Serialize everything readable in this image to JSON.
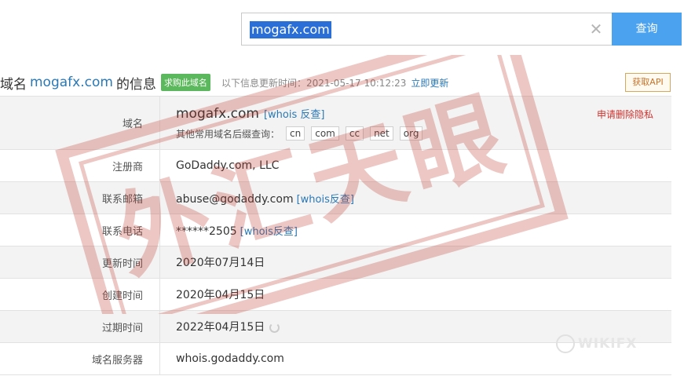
{
  "search": {
    "value": "mogafx.com",
    "clear_icon": "close-icon",
    "button_label": "查询"
  },
  "heading": {
    "prefix": "域名",
    "domain": "mogafx.com",
    "suffix": "的信息",
    "buy_badge": "求购此域名",
    "update_text": "以下信息更新时间：2021-05-17 10:12:23",
    "update_link": "立即更新",
    "api_button": "获取API"
  },
  "table": {
    "domain_row": {
      "label": "域名",
      "domain": "mogafx.com",
      "whois_link": "[whois 反查]",
      "tld_prompt": "其他常用域名后缀查询：",
      "tlds": [
        "cn",
        "com",
        "cc",
        "net",
        "org"
      ],
      "privacy_link": "申请删除隐私"
    },
    "registrar": {
      "label": "注册商",
      "value": "GoDaddy.com, LLC"
    },
    "email": {
      "label": "联系邮箱",
      "value": "abuse@godaddy.com",
      "link": "[whois反查]"
    },
    "phone": {
      "label": "联系电话",
      "value": "******2505",
      "link": "[whois反查]"
    },
    "updated": {
      "label": "更新时间",
      "value": "2020年07月14日"
    },
    "created": {
      "label": "创建时间",
      "value": "2020年04月15日"
    },
    "expires": {
      "label": "过期时间",
      "value": "2022年04月15日"
    },
    "nameserver": {
      "label": "域名服务器",
      "value": "whois.godaddy.com"
    }
  },
  "stamp": {
    "text": "外汇天眼",
    "color": "#c0392b"
  },
  "watermark": {
    "text": "WIKIFX"
  },
  "colors": {
    "accent": "#4ba3ef",
    "link": "#2a78b5",
    "badge": "#5cb85c",
    "danger": "#d2322d"
  }
}
